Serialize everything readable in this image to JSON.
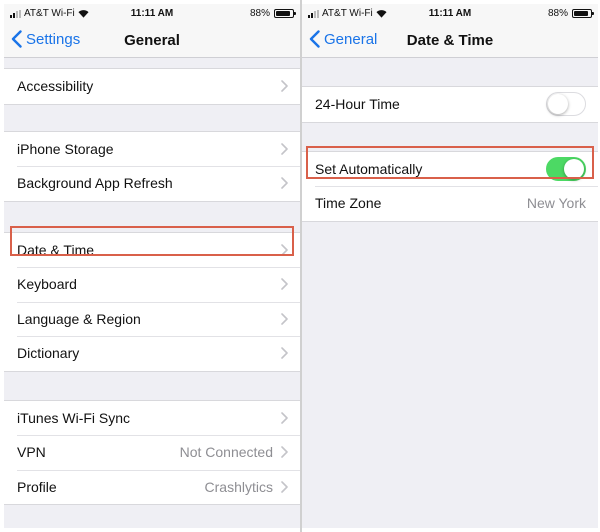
{
  "colors": {
    "accent": "#1a74e8",
    "switch_on": "#4cd964",
    "highlight": "#d9604a",
    "background": "#efeff4"
  },
  "left": {
    "status": {
      "carrier": "AT&T Wi-Fi",
      "time": "11:11 AM",
      "battery": "88%",
      "battery_level": 0.88
    },
    "nav": {
      "back_label": "Settings",
      "title": "General"
    },
    "groups": [
      [
        {
          "label": "Accessibility"
        }
      ],
      [
        {
          "label": "iPhone Storage"
        },
        {
          "label": "Background App Refresh"
        }
      ],
      [
        {
          "label": "Date & Time"
        },
        {
          "label": "Keyboard"
        },
        {
          "label": "Language & Region"
        },
        {
          "label": "Dictionary"
        }
      ],
      [
        {
          "label": "iTunes Wi-Fi Sync"
        },
        {
          "label": "VPN",
          "value": "Not Connected"
        },
        {
          "label": "Profile",
          "value": "Crashlytics"
        }
      ]
    ]
  },
  "right": {
    "status": {
      "carrier": "AT&T Wi-Fi",
      "time": "11:11 AM",
      "battery": "88%",
      "battery_level": 0.88
    },
    "nav": {
      "back_label": "General",
      "title": "Date & Time"
    },
    "rows": {
      "hour24": {
        "label": "24-Hour Time",
        "on": false
      },
      "set_auto": {
        "label": "Set Automatically",
        "on": true
      },
      "time_zone": {
        "label": "Time Zone",
        "value": "New York"
      }
    }
  }
}
